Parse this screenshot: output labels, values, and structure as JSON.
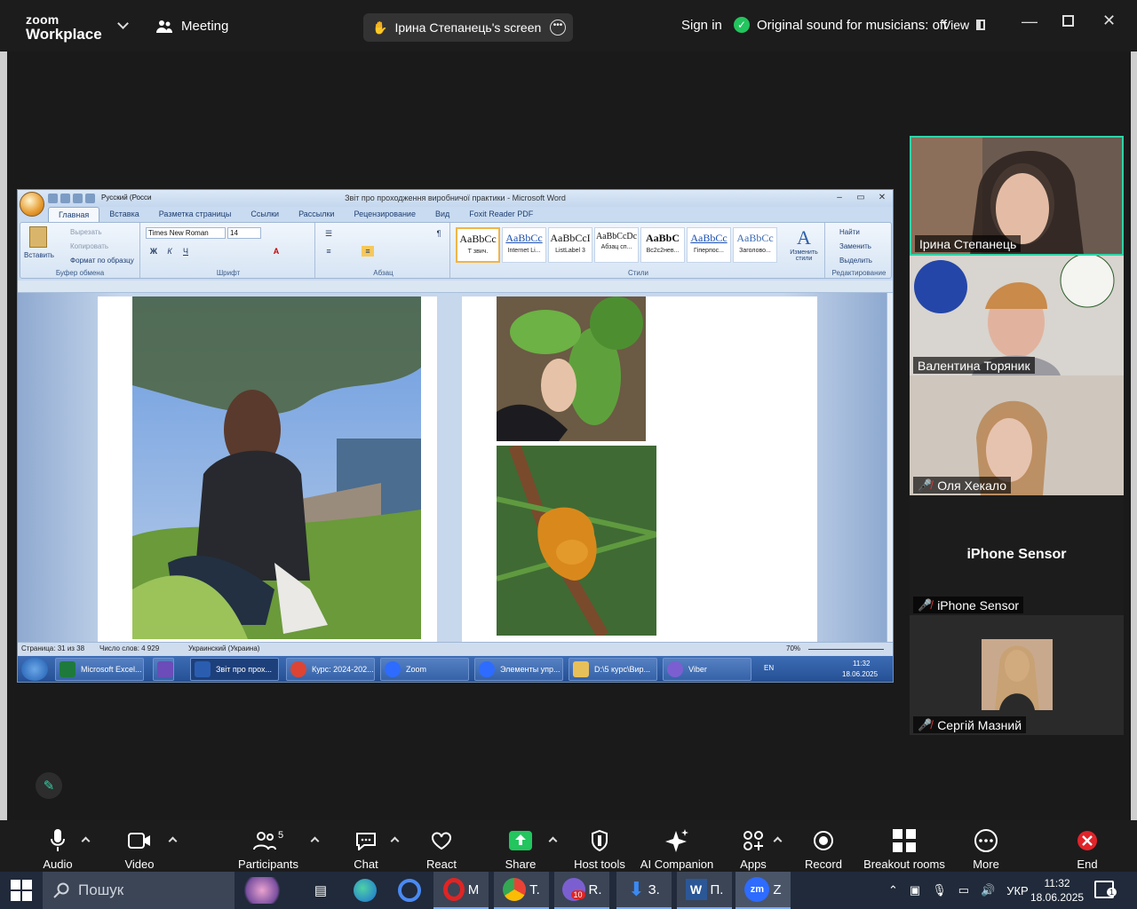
{
  "topbar": {
    "logo_line1": "zoom",
    "logo_line2": "Workplace",
    "meeting_label": "Meeting",
    "screen_share_label": "Ірина Степанець's screen",
    "sign_in": "Sign in",
    "sound_status": "Original sound for musicians: off",
    "view_label": "View"
  },
  "word": {
    "title": "Звіт про проходження виробничої практики - Microsoft Word",
    "tabs": [
      "Главная",
      "Вставка",
      "Разметка страницы",
      "Ссылки",
      "Рассылки",
      "Рецензирование",
      "Вид",
      "Foxit Reader PDF"
    ],
    "clipboard": {
      "paste": "Вставить",
      "cut": "Вырезать",
      "copy": "Копировать",
      "format": "Формат по образцу",
      "group": "Буфер обмена"
    },
    "font": {
      "name": "Times New Roman",
      "size": "14",
      "group": "Шрифт"
    },
    "paragraph_group": "Абзац",
    "styles": [
      {
        "sample": "AaBbCc",
        "name": "Т звич."
      },
      {
        "sample": "AaBbCc",
        "name": "Internet Li..."
      },
      {
        "sample": "AaBbCcI",
        "name": "ListLabel 3"
      },
      {
        "sample": "AaBbCcDc",
        "name": "Абзац сп..."
      },
      {
        "sample": "AaBbC",
        "name": "Вс2с2нев..."
      },
      {
        "sample": "AaBbCc",
        "name": "Гіперпос..."
      },
      {
        "sample": "AaBbCc",
        "name": "Заголово..."
      }
    ],
    "styles_group": "Стили",
    "change_styles": "Изменить стили",
    "editing": {
      "find": "Найти",
      "replace": "Заменить",
      "select": "Выделить",
      "group": "Редактирование"
    },
    "qat_lang": "Русский (Росси",
    "status": {
      "page": "Страница: 31 из 38",
      "words": "Число слов: 4 929",
      "lang": "Украинский (Украина)",
      "zoom": "70%"
    }
  },
  "xp_taskbar": {
    "items": [
      "Microsoft Excel...",
      "Звіт про прох...",
      "Курс: 2024-202...",
      "Zoom",
      "Элементы упр...",
      "D:\\5 курс\\Вир...",
      "Viber"
    ],
    "lang": "EN",
    "time": "11:32",
    "date": "18.06.2025"
  },
  "gallery": [
    {
      "name": "Ірина Степанець",
      "muted": false
    },
    {
      "name": "Валентина Торяник",
      "muted": false
    },
    {
      "name": "Оля Хекало",
      "muted": true
    },
    {
      "name": "iPhone Sensor",
      "muted": true,
      "placeholder": "iPhone Sensor"
    },
    {
      "name": "Сергій Мазний",
      "muted": true
    }
  ],
  "toolbar": {
    "audio": "Audio",
    "video": "Video",
    "participants": "Participants",
    "participants_count": "5",
    "chat": "Chat",
    "react": "React",
    "share": "Share",
    "host_tools": "Host tools",
    "ai_companion": "AI Companion",
    "apps": "Apps",
    "record": "Record",
    "breakout": "Breakout rooms",
    "more": "More",
    "end": "End"
  },
  "win_taskbar": {
    "search": "Пошук",
    "apps": [
      {
        "label": "M"
      },
      {
        "label": "T."
      },
      {
        "label": "R."
      },
      {
        "label": "З."
      },
      {
        "label": "П."
      },
      {
        "label": "Z"
      }
    ],
    "viber_badge": "10",
    "lang": "УКР",
    "time": "11:32",
    "date": "18.06.2025",
    "notif_count": "1"
  }
}
